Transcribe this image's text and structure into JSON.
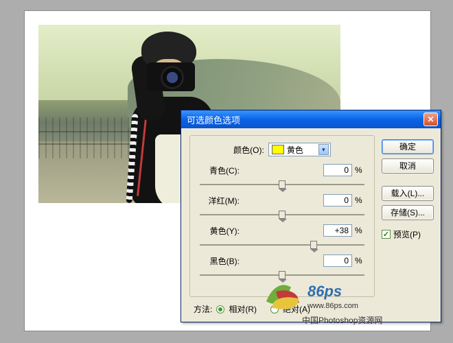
{
  "dialog": {
    "title": "可选颜色选项",
    "color_label": "颜色(O):",
    "color_selected": "黄色",
    "channels": {
      "cyan": {
        "label": "青色(C):",
        "value": "0",
        "percent": "%",
        "pos": 50
      },
      "magenta": {
        "label": "洋红(M):",
        "value": "0",
        "percent": "%",
        "pos": 50
      },
      "yellow": {
        "label": "黄色(Y):",
        "value": "+38",
        "percent": "%",
        "pos": 69
      },
      "black": {
        "label": "黑色(B):",
        "value": "0",
        "percent": "%",
        "pos": 50
      }
    },
    "method": {
      "label": "方法:",
      "relative": "相对(R)",
      "absolute": "绝对(A)",
      "selected": "relative"
    }
  },
  "buttons": {
    "ok": "确定",
    "cancel": "取消",
    "load": "载入(L)...",
    "save": "存储(S)..."
  },
  "preview": {
    "label": "预览(P)",
    "checked": true
  },
  "watermark": {
    "brand": "86ps",
    "url": "www.86ps.com",
    "cn": "中国Photoshop资源网"
  },
  "close_glyph": "✕",
  "caret_glyph": "▾",
  "check_glyph": "✓"
}
